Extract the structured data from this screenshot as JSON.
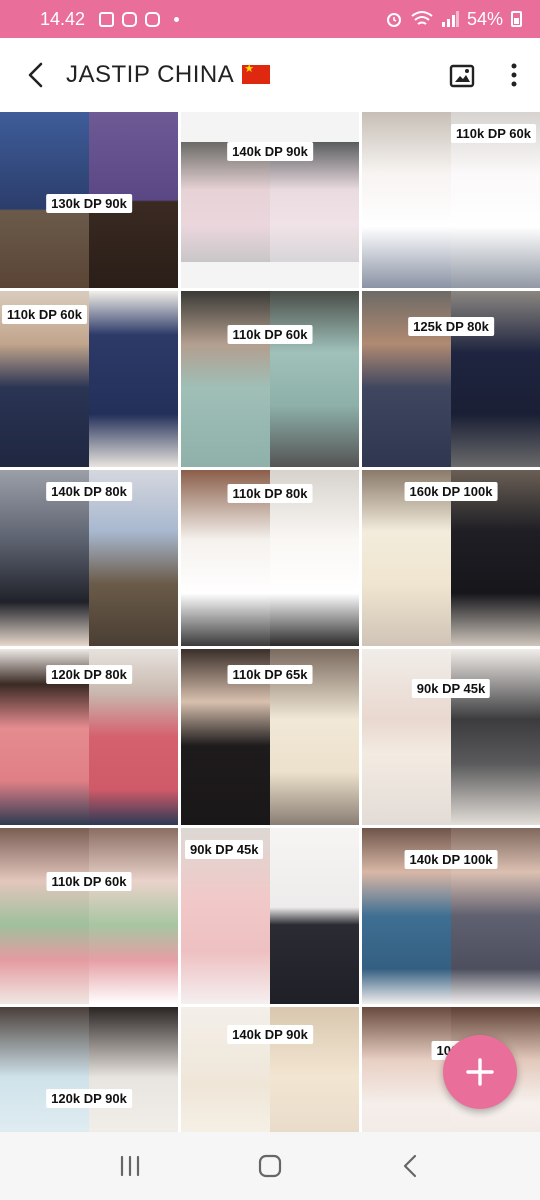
{
  "status_bar": {
    "time": "14.42",
    "battery": "54%",
    "icons": [
      "gallery-icon",
      "instagram-icon",
      "instagram-icon",
      "dot-icon",
      "alarm-icon",
      "wifi-icon",
      "signal-icon",
      "battery-icon"
    ]
  },
  "header": {
    "title": "JASTIP CHINA",
    "flag": "china-flag-icon",
    "actions": [
      "set-wallpaper-icon",
      "more-vert-icon"
    ]
  },
  "colors": {
    "accent": "#ea6e9a",
    "background": "#ffffff"
  },
  "grid": {
    "items": [
      {
        "price": "130k DP 90k"
      },
      {
        "price": "140k DP 90k"
      },
      {
        "price": "110k DP 60k"
      },
      {
        "price": "110k DP 60k"
      },
      {
        "price": "110k DP 60k"
      },
      {
        "price": "125k DP 80k"
      },
      {
        "price": "140k DP 80k"
      },
      {
        "price": "110k DP 80k"
      },
      {
        "price": "160k DP 100k"
      },
      {
        "price": "120k DP 80k"
      },
      {
        "price": "110k DP 65k"
      },
      {
        "price": "90k DP 45k"
      },
      {
        "price": "110k DP 60k"
      },
      {
        "price": "90k DP 45k"
      },
      {
        "price": "140k DP 100k"
      },
      {
        "price": "120k DP 90k"
      },
      {
        "price": "140k DP 90k"
      },
      {
        "price": "100k"
      }
    ]
  },
  "fab": {
    "icon": "plus-icon",
    "label": "+"
  },
  "nav_bar": {
    "buttons": [
      "recent-apps-icon",
      "home-icon",
      "back-icon"
    ]
  }
}
